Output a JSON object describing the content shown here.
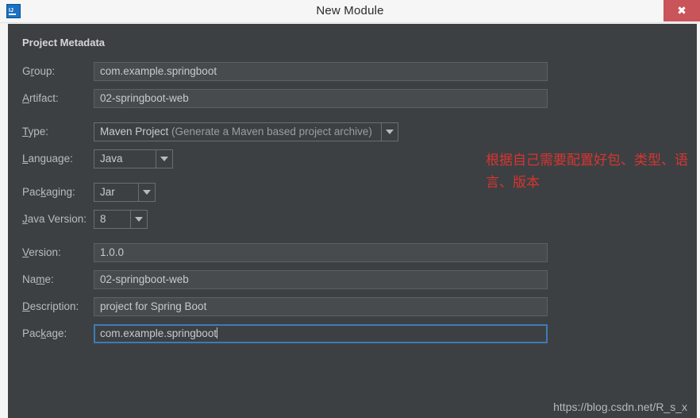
{
  "window": {
    "title": "New Module",
    "app_icon": "intellij-idea-icon",
    "close_label": "✖"
  },
  "colors": {
    "panel_bg": "#3c4043",
    "field_bg": "#484b4d",
    "focus_border": "#3e7bb6",
    "close_button": "#c9545a",
    "annotation": "#d9342f"
  },
  "form": {
    "section_title": "Project Metadata",
    "rows": [
      {
        "label_pre": "G",
        "label_mnemonic": "r",
        "label_post": "oup:",
        "value": "com.example.springboot",
        "kind": "text"
      },
      {
        "label_pre": "",
        "label_mnemonic": "A",
        "label_post": "rtifact:",
        "value": "02-springboot-web",
        "kind": "text"
      },
      {
        "label_pre": "",
        "label_mnemonic": "T",
        "label_post": "ype:",
        "value": "Maven Project",
        "value_dim": " (Generate a Maven based project archive)",
        "kind": "combo"
      },
      {
        "label_pre": "",
        "label_mnemonic": "L",
        "label_post": "anguage:",
        "value": "Java",
        "kind": "combo"
      },
      {
        "label_pre": "Pac",
        "label_mnemonic": "k",
        "label_post": "aging:",
        "value": "Jar",
        "kind": "combo"
      },
      {
        "label_pre": "",
        "label_mnemonic": "J",
        "label_post": "ava Version:",
        "value": "8",
        "kind": "combo"
      },
      {
        "label_pre": "",
        "label_mnemonic": "V",
        "label_post": "ersion:",
        "value": "1.0.0",
        "kind": "text"
      },
      {
        "label_pre": "Na",
        "label_mnemonic": "m",
        "label_post": "e:",
        "value": "02-springboot-web",
        "kind": "text"
      },
      {
        "label_pre": "",
        "label_mnemonic": "D",
        "label_post": "escription:",
        "value": " project for Spring Boot",
        "kind": "text"
      },
      {
        "label_pre": "Pac",
        "label_mnemonic": "k",
        "label_post": "age:",
        "value": "com.example.springboot",
        "kind": "text",
        "focused": true
      }
    ]
  },
  "annotation": {
    "text": "根据自己需要配置好包、类型、语言、版本"
  },
  "watermark": {
    "text": "https://blog.csdn.net/R_s_x"
  }
}
